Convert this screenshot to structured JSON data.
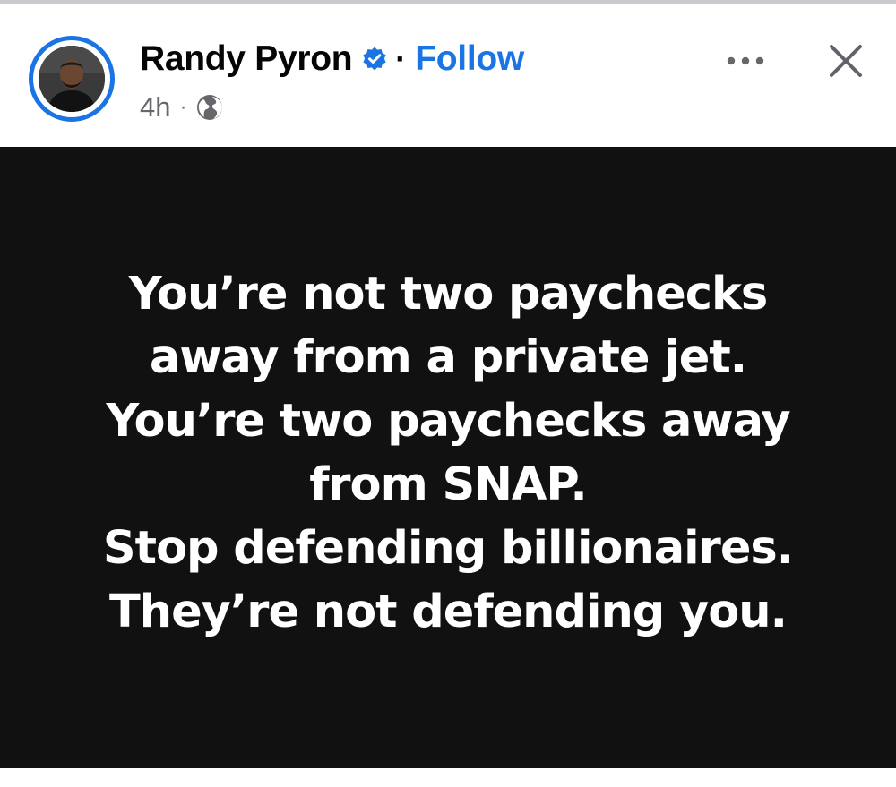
{
  "post": {
    "author_name": "Randy Pyron",
    "separator": "·",
    "follow_label": "Follow",
    "timestamp": "4h",
    "meta_separator": "·",
    "audience_icon": "globe-icon",
    "verified_icon": "verified-badge-icon",
    "more_icon": "more-options-icon",
    "close_icon": "close-icon",
    "image_text_lines": [
      "You’re not two paychecks",
      "away from a private jet.",
      "You’re two paychecks away",
      "from SNAP.",
      "Stop defending billionaires.",
      "They’re not defending you."
    ]
  },
  "colors": {
    "accent": "#1b74e4",
    "text_primary": "#050505",
    "text_secondary": "#65676b",
    "image_background": "#111111",
    "image_text": "#ffffff"
  }
}
